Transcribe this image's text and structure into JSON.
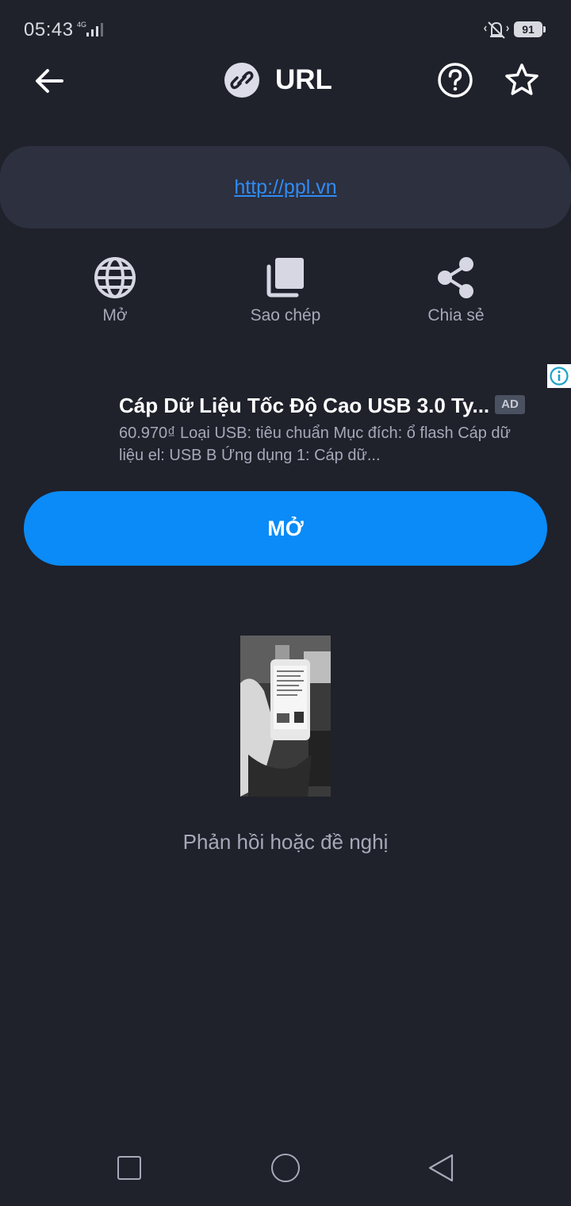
{
  "status_bar": {
    "time": "05:43",
    "network": "4G",
    "battery": "91"
  },
  "header": {
    "title": "URL",
    "icons": [
      "arrow-left-icon",
      "link-icon",
      "help-circle-icon",
      "star-outline-icon"
    ]
  },
  "url_card": {
    "url": "http://ppl.vn"
  },
  "actions": [
    {
      "label": "Mở",
      "icon": "globe-icon"
    },
    {
      "label": "Sao chép",
      "icon": "copy-icon"
    },
    {
      "label": "Chia sẻ",
      "icon": "share-icon"
    }
  ],
  "ad": {
    "title": "Cáp Dữ Liệu Tốc Độ Cao USB 3.0 Ty...",
    "badge": "AD",
    "description": "60.970₫ Loại USB: tiêu chuẩn Mục đích: ổ flash Cáp dữ liệu el: USB B Ứng dụng 1: Cáp dữ...",
    "info_icon": "info-icon"
  },
  "open_button": {
    "label": "MỞ"
  },
  "feedback": {
    "label": "Phản hồi hoặc đề nghị"
  },
  "colors": {
    "background": "#1f212b",
    "card": "#2d303f",
    "accent": "#0a8bf7",
    "link": "#2f8cf6",
    "muted_text": "#a6a9b8"
  }
}
